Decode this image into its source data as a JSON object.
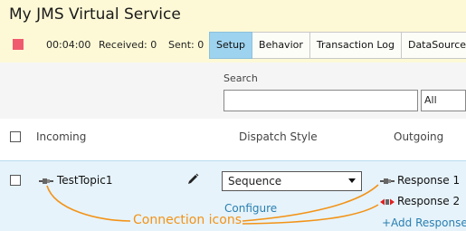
{
  "service": {
    "title": "My JMS Virtual Service",
    "timer": "00:04:00",
    "received": "Received: 0",
    "sent": "Sent: 0"
  },
  "tabs": [
    {
      "label": "Setup",
      "active": true
    },
    {
      "label": "Behavior"
    },
    {
      "label": "Transaction Log"
    },
    {
      "label": "DataSources"
    }
  ],
  "search": {
    "label": "Search",
    "value": "",
    "filter_value": "All"
  },
  "columns": {
    "incoming": "Incoming",
    "dispatch": "Dispatch Style",
    "outgoing": "Outgoing"
  },
  "row": {
    "incoming": "TestTopic1",
    "dispatch_style": "Sequence",
    "configure": "Configure",
    "responses": [
      "Response 1",
      "Response 2"
    ],
    "add_response": "+Add Response"
  },
  "annotation": "Connection icons",
  "colors": {
    "header_bg": "#fdf9d6",
    "active_tab": "#9ed3ef",
    "stop_button": "#f05a6e",
    "row_bg": "#e6f3fb",
    "link": "#2a7fb0",
    "annotation": "#f39316",
    "disconnected_icon": "#e02020"
  },
  "icons": [
    "stop-icon",
    "connection-icon",
    "disconnected-connection-icon",
    "pencil-icon",
    "chevron-down-icon"
  ]
}
